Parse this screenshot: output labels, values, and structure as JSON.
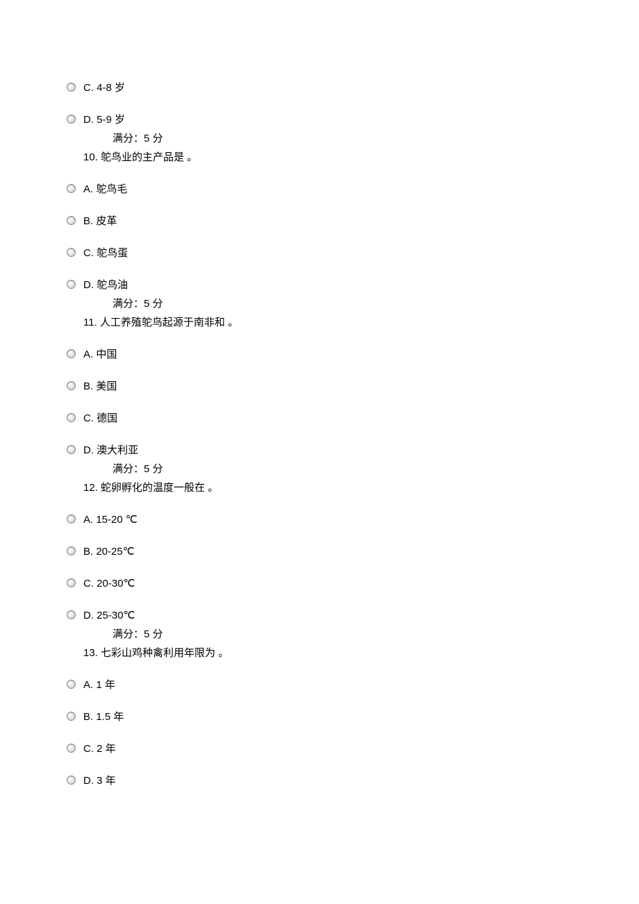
{
  "groups": [
    {
      "preOptions": [
        {
          "name": "option-c-4-8",
          "text": "C. 4-8 岁"
        },
        {
          "name": "option-d-5-9",
          "text": "D. 5-9 岁"
        }
      ],
      "score": "满分：5 分",
      "question": "10.  鸵鸟业的主产品是 。",
      "options": [
        {
          "name": "option-a-feather",
          "text": "A. 鸵鸟毛"
        },
        {
          "name": "option-b-leather",
          "text": "B. 皮革"
        },
        {
          "name": "option-c-egg",
          "text": "C. 鸵鸟蛋"
        },
        {
          "name": "option-d-oil",
          "text": "D. 鸵鸟油"
        }
      ]
    },
    {
      "preOptions": [],
      "score": "满分：5 分",
      "question": "11.  人工养殖鸵鸟起源于南非和 。",
      "options": [
        {
          "name": "option-a-china",
          "text": "A. 中国"
        },
        {
          "name": "option-b-usa",
          "text": "B. 美国"
        },
        {
          "name": "option-c-germany",
          "text": "C. 德国"
        },
        {
          "name": "option-d-australia",
          "text": "D. 澳大利亚"
        }
      ]
    },
    {
      "preOptions": [],
      "score": "满分：5 分",
      "question": "12.  蛇卵孵化的温度一般在 。",
      "options": [
        {
          "name": "option-a-15-20",
          "text": "A. 15-20 ℃"
        },
        {
          "name": "option-b-20-25",
          "text": "B. 20-25℃"
        },
        {
          "name": "option-c-20-30",
          "text": "C. 20-30℃"
        },
        {
          "name": "option-d-25-30",
          "text": "D. 25-30℃"
        }
      ]
    },
    {
      "preOptions": [],
      "score": "满分：5 分",
      "question": "13.  七彩山鸡种禽利用年限为 。",
      "options": [
        {
          "name": "option-a-1year",
          "text": "A. 1 年"
        },
        {
          "name": "option-b-1-5year",
          "text": "B. 1.5 年"
        },
        {
          "name": "option-c-2year",
          "text": "C. 2 年"
        },
        {
          "name": "option-d-3year",
          "text": "D. 3 年"
        }
      ]
    }
  ]
}
